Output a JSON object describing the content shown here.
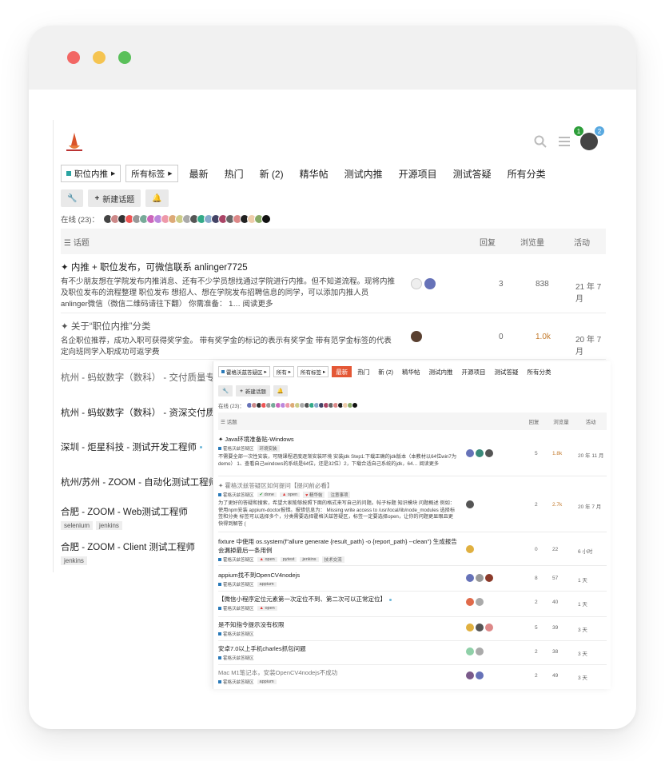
{
  "back": {
    "nav": {
      "category_select": "职位内推",
      "tag_select": "所有标签",
      "tabs": [
        "最新",
        "热门",
        "新 (2)",
        "精华帖",
        "测试内推",
        "开源项目",
        "测试答疑",
        "所有分类"
      ]
    },
    "actions": {
      "new_topic": "新建话题"
    },
    "online_label": "在线 (23)：",
    "table_header": {
      "topic": "话题",
      "replies": "回复",
      "views": "浏览量",
      "activity": "活动"
    },
    "badges": {
      "notifications": "1",
      "messages": "2"
    },
    "topics": [
      {
        "title": "内推 + 职位发布，可微信联系 anlinger7725",
        "excerpt": "有不少朋友想在学院发布内推消息、还有不少学员想找通过学院进行内推。但不知道流程。现将内推及职位发布的流程整理 职位发布 想招人、想在学院发布招聘信息的同学，可以添加内推人员 anlinger微信（微信二维码请往下翻） 你需准备： 1… 阅读更多",
        "replies": "3",
        "views": "838",
        "activity": "21 年 7 月"
      },
      {
        "title": "关于“职位内推”分类",
        "excerpt": "名企职位推荐，成功入职可获得奖学金。 带有奖学金的标记的表示有奖学金 带有范学金标签的代表定向班同学入职成功可返学费",
        "replies": "0",
        "views": "1.0k",
        "activity": "20 年 7 月"
      }
    ],
    "list": [
      {
        "title": "杭州 - 蚂蚁数字（数科） - 交付质量专家",
        "tags": []
      },
      {
        "title": "杭州 - 蚂蚁数字（数科） - 资深交付质量",
        "tags": []
      },
      {
        "title": "深圳 - 炬星科技 - 测试开发工程师",
        "tags": []
      },
      {
        "title": "杭州/苏州 - ZOOM - 自动化测试工程师",
        "tags": []
      },
      {
        "title": "合肥 - ZOOM - Web测试工程师",
        "tags": [
          "selenium",
          "jenkins"
        ]
      },
      {
        "title": "合肥 - ZOOM - Client 测试工程师",
        "tags": [
          "jenkins"
        ]
      }
    ]
  },
  "front": {
    "nav": {
      "category_select": "霍格沃兹答疑区",
      "sub_select": "所有",
      "tag_select": "所有标签",
      "active_tab": "最新",
      "tabs": [
        "热门",
        "新 (2)",
        "精华帖",
        "测试内推",
        "开源项目",
        "测试答疑",
        "所有分类"
      ]
    },
    "actions": {
      "new_topic": "新建话题"
    },
    "online_label": "在线 (23)：",
    "table_header": {
      "topic": "话题",
      "replies": "回复",
      "views": "浏览量",
      "activity": "活动"
    },
    "topics": [
      {
        "title": "Java环境准备贴-Windows",
        "category": "霍格沃兹答疑区",
        "tags": [
          "环境安装"
        ],
        "excerpt": "不需要全部一次性安装，可随课程进度逐渐安装环境 安装jdk Step1:下载正确的jdk版本（本教材以64位win7为demo） 1、查看自己windows的系统是64位，还是32位）2，下载合适自己系统的jdk，64… 阅读更多",
        "replies": "5",
        "views": "1.8k",
        "activity": "20 年 11 月"
      },
      {
        "title": "霍格沃兹答疑区如何提问【提问前必看】",
        "category": "霍格沃兹答疑区",
        "tags": [
          "done",
          "open",
          "精华帖",
          "注意事项"
        ],
        "excerpt": "为了更好的答疑和搜索，希望大家能够按照下面的格式来写自己的问题。帖子标题 知识模块 问题概述 例如： 使用npm安装 appium-doctor报错。报错信息为： Missing write access to /usr/local/lib/node_modules 选择标签和分类 标签可以选择多个，分类需要选择霍格沃兹答疑区，标签一定要选择open，让你的问题更显眼且更快得到解答 (",
        "replies": "2",
        "views": "2.7k",
        "activity": "20 年 7 月"
      },
      {
        "title": "fixture 中使用 os.system(f\"allure generate {result_path} -o {report_path} --clean\") 生成报告会漏掉最后一条用例",
        "category": "霍格沃兹答疑区",
        "tags": [
          "open",
          "pytest",
          "jenkins",
          "技术交流"
        ],
        "replies": "0",
        "views": "22",
        "activity": "6 小时"
      },
      {
        "title": "appium找不到OpenCV4nodejs",
        "category": "霍格沃兹答疑区",
        "tags": [
          "appium"
        ],
        "replies": "8",
        "views": "57",
        "activity": "1 天"
      },
      {
        "title": "【微信小程序定位元素第一次定位不到、第二次可以正常定位】",
        "category": "霍格沃兹答疑区",
        "tags": [
          "open"
        ],
        "replies": "2",
        "views": "40",
        "activity": "1 天"
      },
      {
        "title": "是不知指令提示没有权限",
        "category": "霍格沃兹答疑区",
        "tags": [],
        "replies": "5",
        "views": "39",
        "activity": "3 天"
      },
      {
        "title": "安卓7.0以上手机charles抓包问题",
        "category": "霍格沃兹答疑区",
        "tags": [],
        "replies": "2",
        "views": "38",
        "activity": "3 天"
      },
      {
        "title": "Mac M1笔记本，安装OpenCV4nodejs不成功",
        "category": "霍格沃兹答疑区",
        "tags": [
          "appium"
        ],
        "replies": "2",
        "views": "49",
        "activity": "3 天"
      }
    ]
  },
  "colors": {
    "accent_orange": "#e45735",
    "teal": "#2aa4a1",
    "hot_views": "#c37a2c",
    "window_red": "#f26764",
    "window_yellow": "#f5c451",
    "window_green": "#5ac05a"
  }
}
